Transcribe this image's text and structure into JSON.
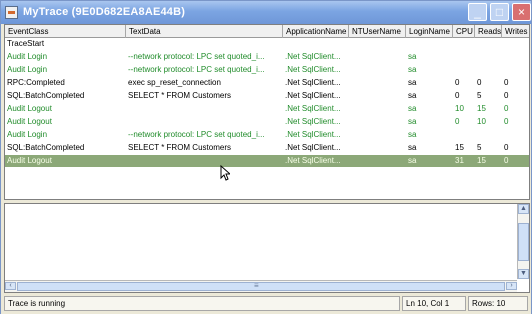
{
  "window": {
    "title": "MyTrace (9E0D682EA8AE44B)",
    "controls": {
      "minimize": "_",
      "maximize": "□",
      "close": "×"
    },
    "colors": {
      "title_bar": "#6f97d8",
      "selected_row": "#8ca878",
      "green_event": "#218c2b"
    }
  },
  "trace_grid": {
    "columns": [
      "EventClass",
      "TextData",
      "ApplicationName",
      "NTUserName",
      "LoginName",
      "CPU",
      "Reads",
      "Writes"
    ],
    "rows": [
      {
        "EventClass": "TraceStart",
        "TextData": "",
        "ApplicationName": "",
        "NTUserName": "",
        "LoginName": "",
        "CPU": "",
        "Reads": "",
        "Writes": "",
        "style": "black"
      },
      {
        "EventClass": "Audit Login",
        "TextData": "--network protocol: LPC set quoted_i...",
        "ApplicationName": ".Net SqlClient...",
        "NTUserName": "",
        "LoginName": "sa",
        "CPU": "",
        "Reads": "",
        "Writes": "",
        "style": "green"
      },
      {
        "EventClass": "Audit Login",
        "TextData": "--network protocol: LPC set quoted_i...",
        "ApplicationName": ".Net SqlClient...",
        "NTUserName": "",
        "LoginName": "sa",
        "CPU": "",
        "Reads": "",
        "Writes": "",
        "style": "green"
      },
      {
        "EventClass": "RPC:Completed",
        "TextData": "exec sp_reset_connection",
        "ApplicationName": ".Net SqlClient...",
        "NTUserName": "",
        "LoginName": "sa",
        "CPU": "0",
        "Reads": "0",
        "Writes": "0",
        "style": "black"
      },
      {
        "EventClass": "SQL:BatchCompleted",
        "TextData": "SELECT * FROM Customers",
        "ApplicationName": ".Net SqlClient...",
        "NTUserName": "",
        "LoginName": "sa",
        "CPU": "0",
        "Reads": "5",
        "Writes": "0",
        "style": "black"
      },
      {
        "EventClass": "Audit Logout",
        "TextData": "",
        "ApplicationName": ".Net SqlClient...",
        "NTUserName": "",
        "LoginName": "sa",
        "CPU": "10",
        "Reads": "15",
        "Writes": "0",
        "style": "green"
      },
      {
        "EventClass": "Audit Logout",
        "TextData": "",
        "ApplicationName": ".Net SqlClient...",
        "NTUserName": "",
        "LoginName": "sa",
        "CPU": "0",
        "Reads": "10",
        "Writes": "0",
        "style": "green"
      },
      {
        "EventClass": "Audit Login",
        "TextData": "--network protocol: LPC set quoted_i...",
        "ApplicationName": ".Net SqlClient...",
        "NTUserName": "",
        "LoginName": "sa",
        "CPU": "",
        "Reads": "",
        "Writes": "",
        "style": "green"
      },
      {
        "EventClass": "SQL:BatchCompleted",
        "TextData": "SELECT * FROM Customers",
        "ApplicationName": ".Net SqlClient...",
        "NTUserName": "",
        "LoginName": "sa",
        "CPU": "15",
        "Reads": "5",
        "Writes": "0",
        "style": "black"
      },
      {
        "EventClass": "Audit Logout",
        "TextData": "",
        "ApplicationName": ".Net SqlClient...",
        "NTUserName": "",
        "LoginName": "sa",
        "CPU": "31",
        "Reads": "15",
        "Writes": "0",
        "style": "selected"
      }
    ]
  },
  "scroll": {
    "left_arrow": "‹",
    "right_arrow": "›",
    "up_arrow": "▲",
    "down_arrow": "▼"
  },
  "status": {
    "message": "Trace is running",
    "position": "Ln 10, Col 1",
    "rows": "Rows: 10"
  }
}
